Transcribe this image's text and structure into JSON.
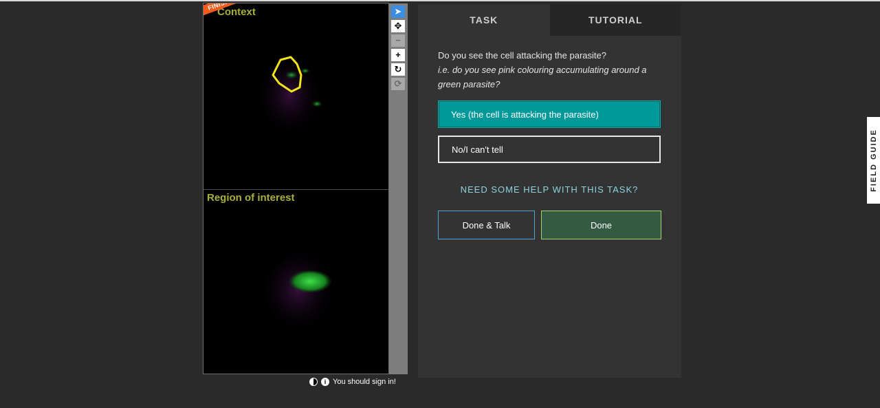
{
  "viewer": {
    "ribbon": "FINISHED!",
    "top_frame_label": "Context",
    "bottom_frame_label": "Region of interest",
    "tools": [
      {
        "name": "pointer",
        "glyph": "➤"
      },
      {
        "name": "pan",
        "glyph": "✥"
      },
      {
        "name": "zoom-out",
        "glyph": "−"
      },
      {
        "name": "zoom-in",
        "glyph": "+"
      },
      {
        "name": "rotate",
        "glyph": "↻"
      },
      {
        "name": "reset",
        "glyph": "⟳"
      }
    ],
    "signin_text": "You should sign in!"
  },
  "tabs": {
    "task": "TASK",
    "tutorial": "TUTORIAL"
  },
  "task": {
    "question": "Do you see the cell attacking the parasite?",
    "question_sub": "i.e. do you see pink colouring accumulating around a green parasite?",
    "answers": [
      {
        "label": "Yes (the cell is attacking the parasite)",
        "selected": true
      },
      {
        "label": "No/I can't tell",
        "selected": false
      }
    ],
    "help_link": "NEED SOME HELP WITH THIS TASK?",
    "done_talk": "Done & Talk",
    "done": "Done"
  },
  "field_guide": "FIELD GUIDE",
  "colors": {
    "accent_teal": "#009899",
    "label_yellow": "#a7b03a",
    "ribbon_orange": "#f05a1a",
    "done_green": "#345a43"
  }
}
